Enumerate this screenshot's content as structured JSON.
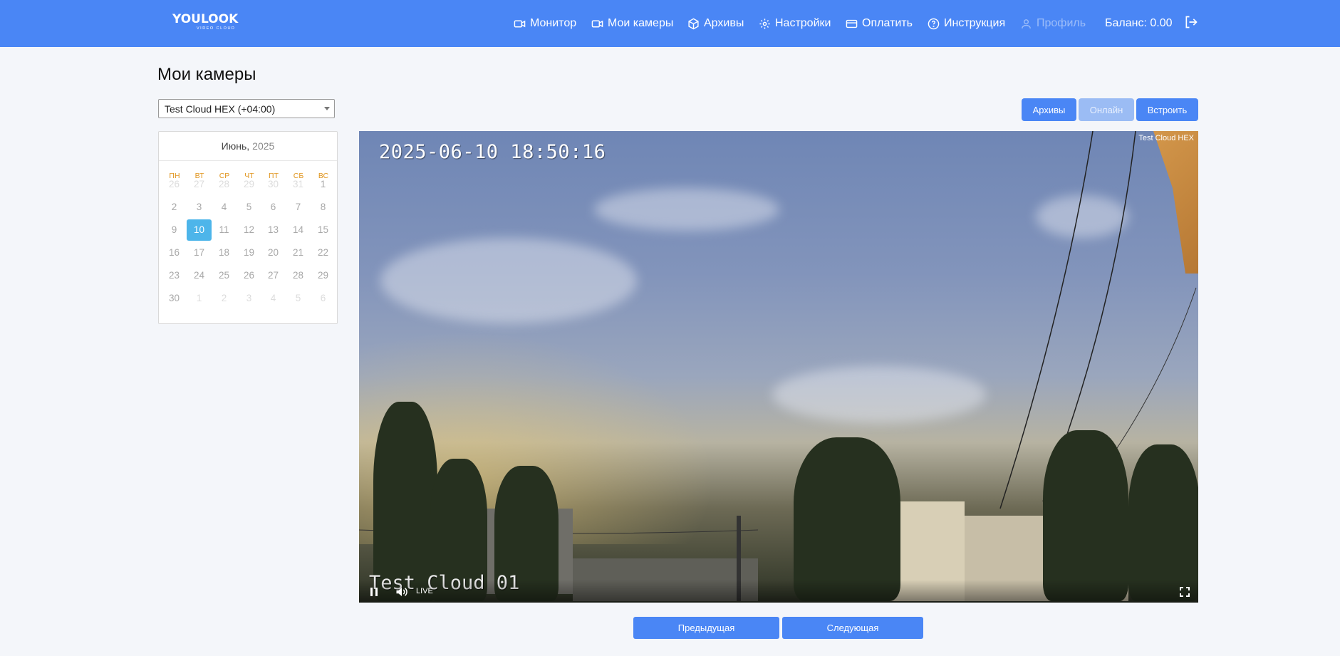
{
  "header": {
    "logo_text": "YOULOOK",
    "logo_sub": "VIDEO CLOUD",
    "nav": [
      {
        "label": "Монитор",
        "icon": "video-camera-icon"
      },
      {
        "label": "Мои камеры",
        "icon": "video-camera-icon"
      },
      {
        "label": "Архивы",
        "icon": "box-icon"
      },
      {
        "label": "Настройки",
        "icon": "gear-icon"
      },
      {
        "label": "Оплатить",
        "icon": "credit-card-icon"
      },
      {
        "label": "Инструкция",
        "icon": "help-circle-icon"
      },
      {
        "label": "Профиль",
        "icon": "user-icon",
        "disabled": true
      }
    ],
    "balance": "Баланс: 0.00",
    "accent_color": "#4a86f5"
  },
  "page": {
    "title": "Мои камеры"
  },
  "camera_select": {
    "value": "Test Cloud HEX (+04:00)"
  },
  "calendar": {
    "month": "Июнь,",
    "year": "2025",
    "weekdays": [
      "ПН",
      "ВТ",
      "СР",
      "ЧТ",
      "ПТ",
      "СБ",
      "ВС"
    ],
    "weeks": [
      [
        "26",
        "27",
        "28",
        "29",
        "30",
        "31",
        "1"
      ],
      [
        "2",
        "3",
        "4",
        "5",
        "6",
        "7",
        "8"
      ],
      [
        "9",
        "10",
        "11",
        "12",
        "13",
        "14",
        "15"
      ],
      [
        "16",
        "17",
        "18",
        "19",
        "20",
        "21",
        "22"
      ],
      [
        "23",
        "24",
        "25",
        "26",
        "27",
        "28",
        "29"
      ],
      [
        "30",
        "1",
        "2",
        "3",
        "4",
        "5",
        "6"
      ]
    ],
    "selected_day": "10",
    "selected_color": "#4db5ea"
  },
  "view_buttons": {
    "archives": "Архивы",
    "online": "Онлайн",
    "embed": "Встроить"
  },
  "video": {
    "timestamp": "2025-06-10 18:50:16",
    "osd_name": "Test Cloud 01",
    "camera_label": "Test Cloud HEX",
    "live_label": "LIVE"
  },
  "pagination": {
    "prev": "Предыдущая",
    "next": "Следующая"
  }
}
